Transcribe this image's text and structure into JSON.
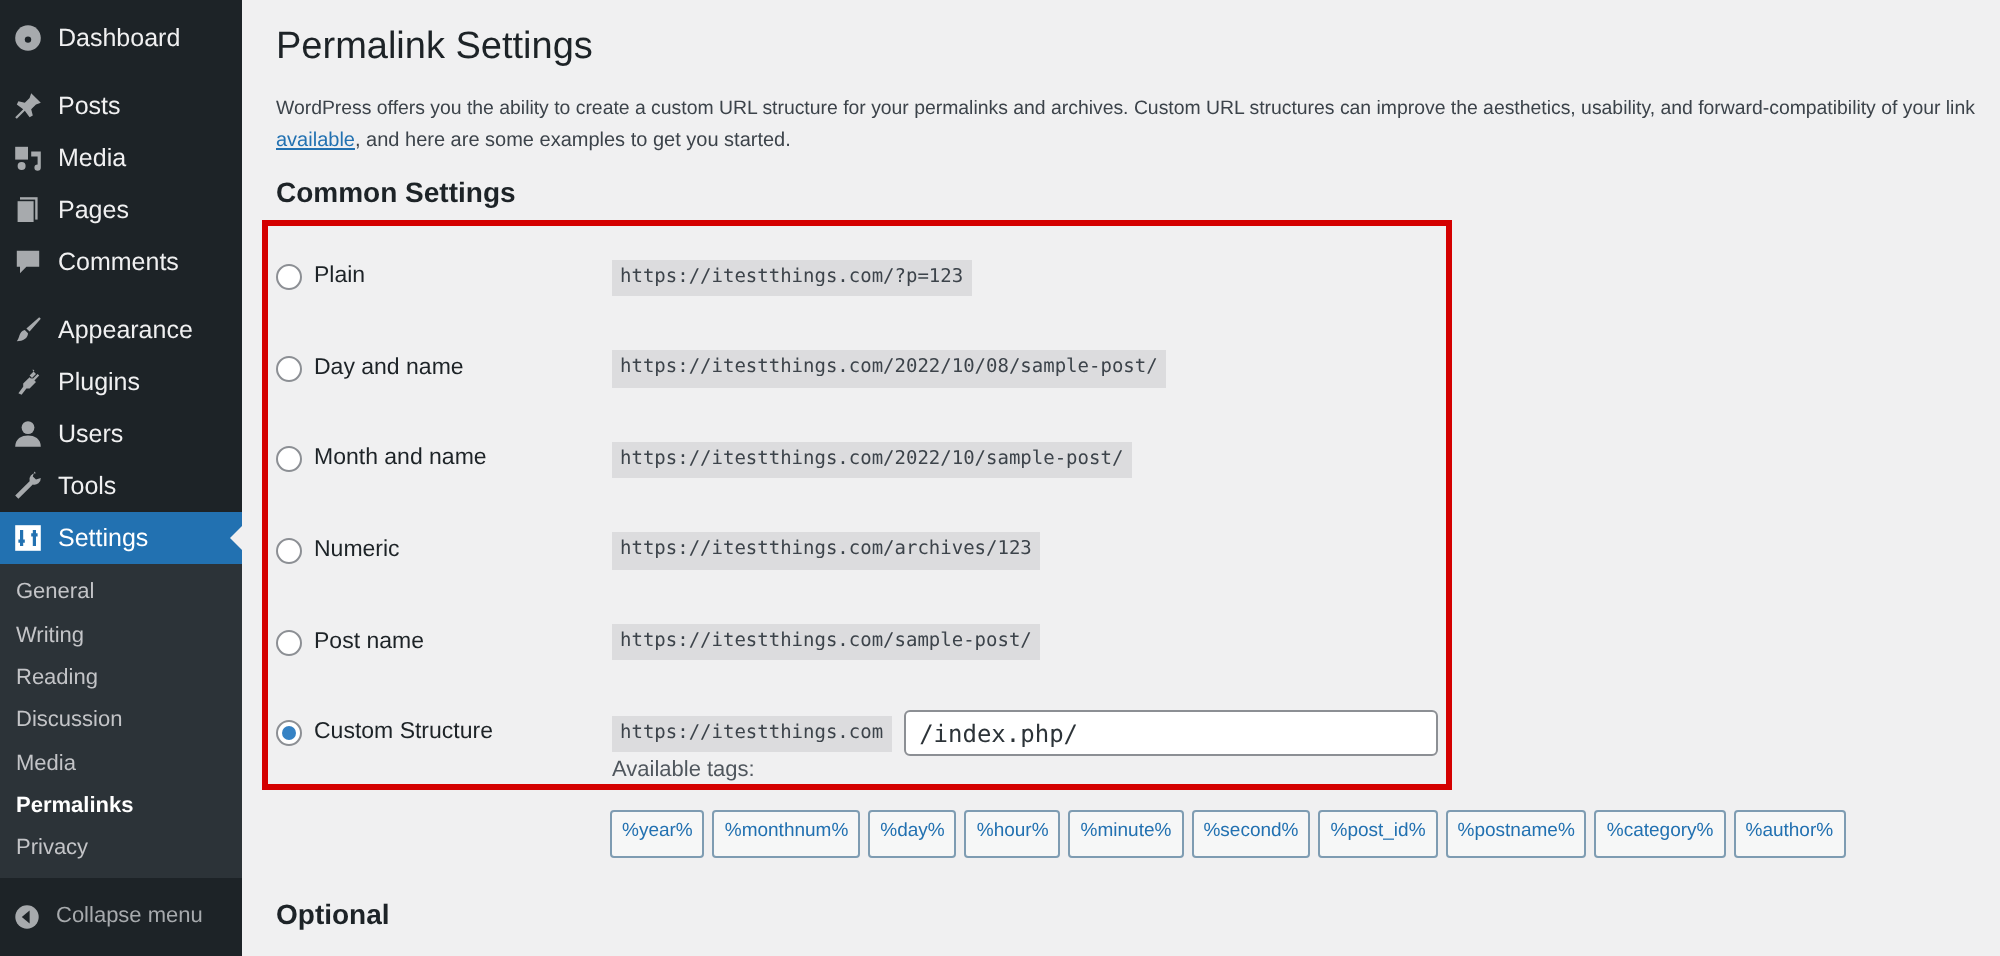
{
  "sidebar": {
    "items": [
      {
        "label": "Dashboard",
        "selected": false
      },
      {
        "label": "Posts",
        "selected": false
      },
      {
        "label": "Media",
        "selected": false
      },
      {
        "label": "Pages",
        "selected": false
      },
      {
        "label": "Comments",
        "selected": false
      },
      {
        "label": "Appearance",
        "selected": false
      },
      {
        "label": "Plugins",
        "selected": false
      },
      {
        "label": "Users",
        "selected": false
      },
      {
        "label": "Tools",
        "selected": false
      },
      {
        "label": "Settings",
        "selected": true
      }
    ],
    "submenu": [
      {
        "label": "General",
        "selected": false
      },
      {
        "label": "Writing",
        "selected": false
      },
      {
        "label": "Reading",
        "selected": false
      },
      {
        "label": "Discussion",
        "selected": false
      },
      {
        "label": "Media",
        "selected": false
      },
      {
        "label": "Permalinks",
        "selected": true
      },
      {
        "label": "Privacy",
        "selected": false
      }
    ],
    "collapse": "Collapse menu"
  },
  "page": {
    "title": "Permalink Settings",
    "intro_line": "WordPress offers you the ability to create a custom URL structure for your permalinks and archives. Custom URL structures can improve the aesthetics, usability, and forward-compatibility of your link",
    "intro_link": "available",
    "intro_rest": ", and here are some examples to get you started.",
    "section": "Common Settings",
    "options": [
      {
        "label": "Plain",
        "example": "https://itestthings.com/?p=123",
        "selected": false
      },
      {
        "label": "Day and name",
        "example": "https://itestthings.com/2022/10/08/sample-post/",
        "selected": false
      },
      {
        "label": "Month and name",
        "example": "https://itestthings.com/2022/10/sample-post/",
        "selected": false
      },
      {
        "label": "Numeric",
        "example": "https://itestthings.com/archives/123",
        "selected": false
      },
      {
        "label": "Post name",
        "example": "https://itestthings.com/sample-post/",
        "selected": false
      },
      {
        "label": "Custom Structure",
        "example": "https://itestthings.com",
        "selected": true,
        "value": "/index.php/"
      }
    ],
    "tags_label": "Available tags:",
    "tags": [
      "%year%",
      "%monthnum%",
      "%day%",
      "%hour%",
      "%minute%",
      "%second%",
      "%post_id%",
      "%postname%",
      "%category%",
      "%author%"
    ],
    "next_section": "Optional"
  }
}
